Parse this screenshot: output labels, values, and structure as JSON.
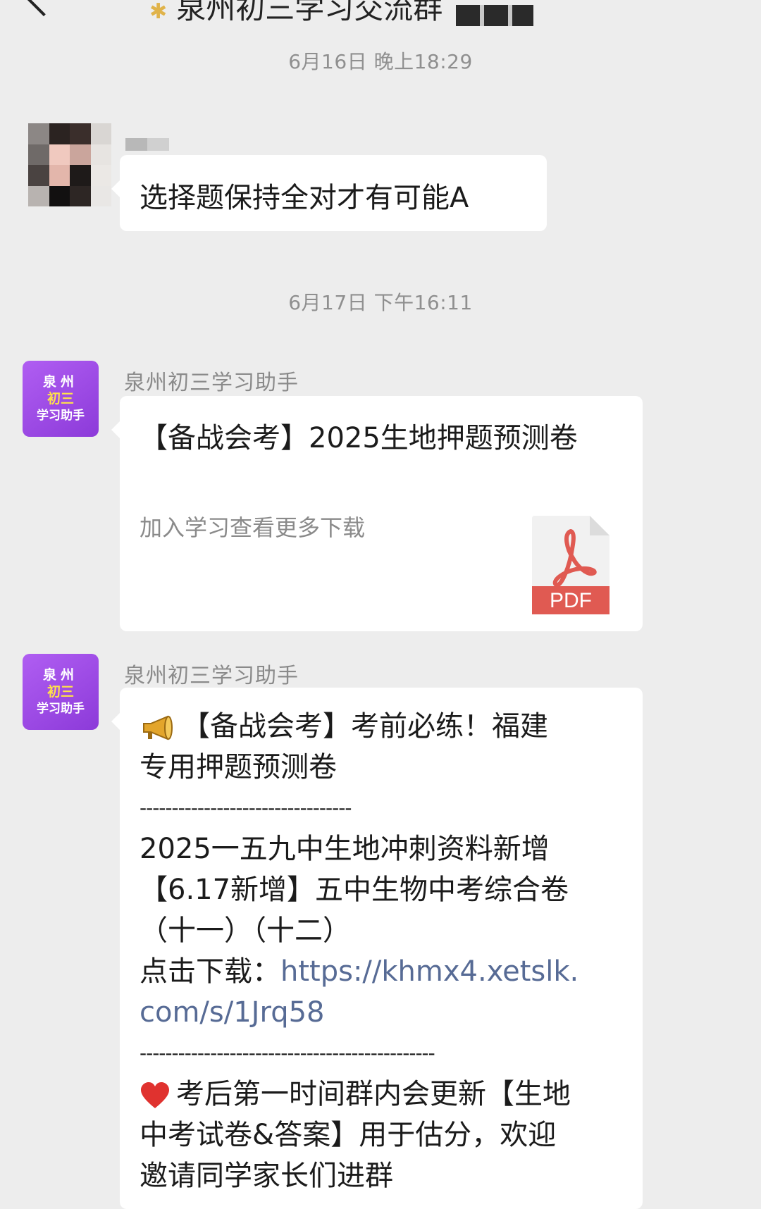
{
  "header": {
    "title": "泉州初三学习交流群"
  },
  "timestamps": [
    "6月16日 晚上18:29",
    "6月17日 下午16:11"
  ],
  "messages": {
    "m1": {
      "text": "选择题保持全对才有可能A"
    },
    "m2": {
      "sender": "泉州初三学习助手",
      "avatar_lines": [
        "泉州",
        "初三",
        "学习助手"
      ],
      "card_title": "【备战会考】2025生地押题预测卷",
      "card_desc": "加入学习查看更多下载",
      "file_type": "PDF"
    },
    "m3": {
      "sender": "泉州初三学习助手",
      "avatar_lines": [
        "泉州",
        "初三",
        "学习助手"
      ],
      "line1": "【备战会考】考前必练！福建",
      "line2": "专用押题预测卷",
      "divider1": "---------------------------------",
      "line3": "2025一五九中生地冲刺资料新增",
      "line4": "【6.17新增】五中生物中考综合卷",
      "line5": "（十一）（十二）",
      "link_label": "点击下载：",
      "link_part1": "https://khmx4.xetslk.",
      "link_part2": "com/s/1Jrq58",
      "divider2": "----------------------------------------------",
      "line6": "考后第一时间群内会更新【生地",
      "line7": "中考试卷&答案】用于估分，欢迎",
      "line8": "邀请同学家长们进群"
    }
  },
  "colors": {
    "background": "#ededed",
    "bubble": "#ffffff",
    "link": "#576b95",
    "bot_avatar": "#a14fe8",
    "pdf_red": "#e05a52"
  },
  "icons": [
    "back-icon",
    "megaphone-icon",
    "heart-icon",
    "pdf-icon"
  ]
}
